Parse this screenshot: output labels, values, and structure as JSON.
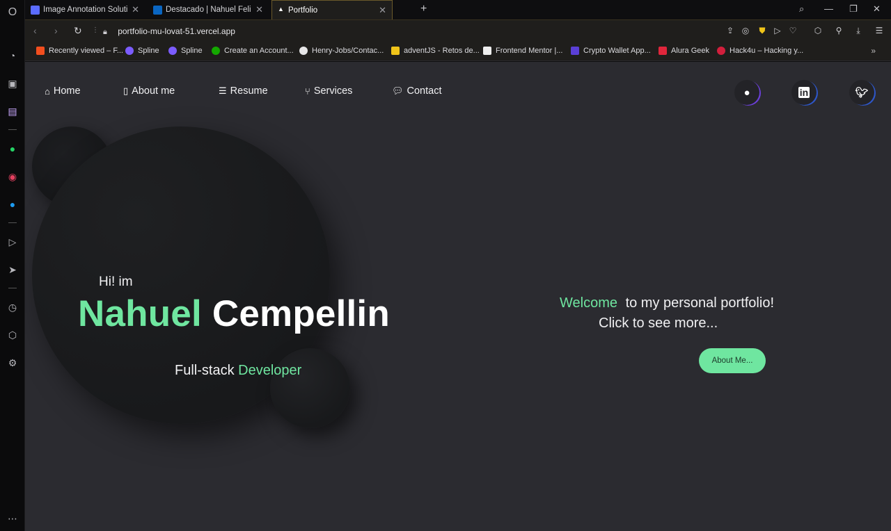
{
  "tabs": [
    {
      "title": "Image Annotation Solution",
      "favicon_color": "#5b6cff"
    },
    {
      "title": "Destacado | Nahuel Felipe Cempellin",
      "favicon_color": "#0a66c2"
    },
    {
      "title": "Portfolio",
      "favicon_color": "#ffffff"
    }
  ],
  "window_controls": {
    "search": "⌕",
    "minimize": "—",
    "restore": "❐",
    "close": "✕"
  },
  "address": {
    "url": "portfolio-mu-lovat-51.vercel.app"
  },
  "bookmarks": [
    {
      "label": "Recently viewed – F...",
      "color": "#f24e1e"
    },
    {
      "label": "Spline",
      "color": "#7b5cff"
    },
    {
      "label": "Spline",
      "color": "#7b5cff"
    },
    {
      "label": "Create an Account...",
      "color": "#14a800"
    },
    {
      "label": "Henry-Jobs/Contac...",
      "color": "#e6e6e6"
    },
    {
      "label": "adventJS - Retos de...",
      "color": "#f0c419"
    },
    {
      "label": "Frontend Mentor |...",
      "color": "#eeeeee"
    },
    {
      "label": "Crypto Wallet App...",
      "color": "#5a3fd6"
    },
    {
      "label": "Alura Geek",
      "color": "#e0263b"
    },
    {
      "label": "Hack4u – Hacking y...",
      "color": "#d21f3c"
    }
  ],
  "nav": {
    "home": "Home",
    "about": "About me",
    "resume": "Resume",
    "services": "Services",
    "contact": "Contact"
  },
  "hero": {
    "greeting": "Hi! im",
    "first_name": "Nahuel",
    "last_name": "Cempellin",
    "role_prefix": "Full-stack",
    "role_accent": "Developer"
  },
  "cta": {
    "welcome_accent": "Welcome",
    "welcome_rest": "to my personal portfolio!",
    "click_text": "Click to see more...",
    "button": "About Me..."
  },
  "colors": {
    "accent": "#6fe6a0",
    "page_bg": "#2b2b30"
  }
}
